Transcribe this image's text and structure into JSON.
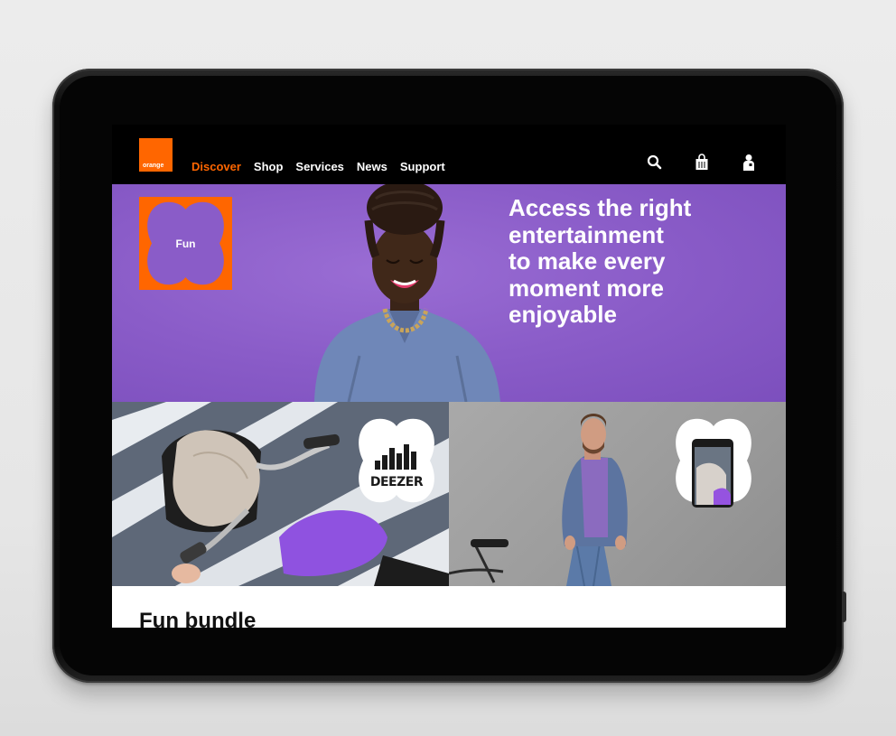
{
  "brand": {
    "logo_text": "orange",
    "accent": "#ff6600",
    "hero_purple": "#8a5cc8"
  },
  "nav": {
    "items": [
      {
        "label": "Discover",
        "active": true
      },
      {
        "label": "Shop",
        "active": false
      },
      {
        "label": "Services",
        "active": false
      },
      {
        "label": "News",
        "active": false
      },
      {
        "label": "Support",
        "active": false
      }
    ]
  },
  "header_icons": [
    "search-icon",
    "basket-icon",
    "account-icon"
  ],
  "hero": {
    "tile_label": "Fun",
    "title_lines": [
      "Access the right",
      "entertainment",
      "to make every",
      "moment more",
      "enjoyable"
    ]
  },
  "tiles": {
    "left_badge_text": "DEEZER",
    "right_badge_icon": "smartphone-icon"
  },
  "section": {
    "title": "Fun bundle"
  }
}
